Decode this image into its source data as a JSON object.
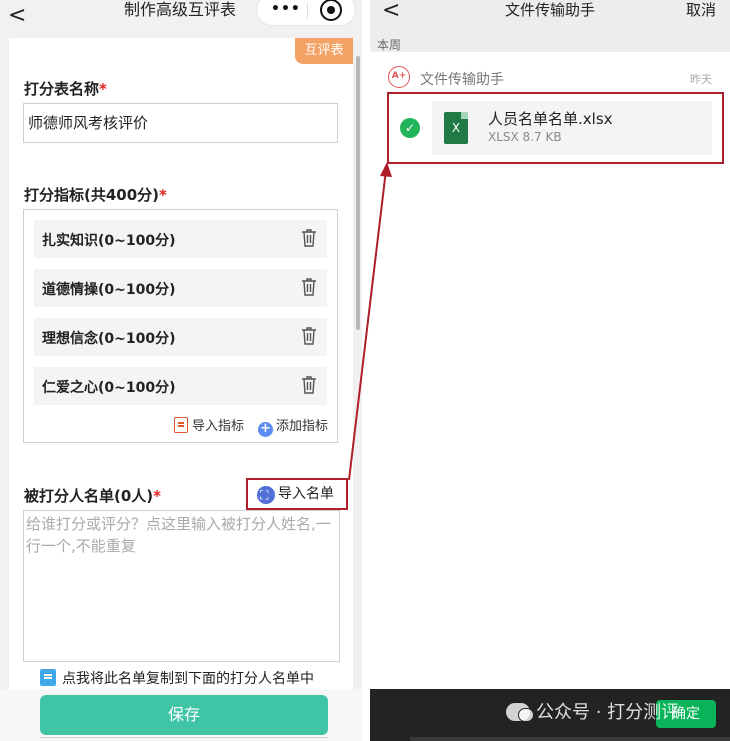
{
  "left": {
    "title": "制作高级互评表",
    "tag": "互评表",
    "form_name_label": "打分表名称",
    "form_name_value": "师德师风考核评价",
    "indicators_label": "打分指标(共400分)",
    "indicators": [
      "扎实知识(0~100分)",
      "道德情操(0~100分)",
      "理想信念(0~100分)",
      "仁爱之心(0~100分)"
    ],
    "import_indicators": "导入指标",
    "add_indicator": "添加指标",
    "targets_label": "被打分人名单(0人)",
    "import_list": "导入名单",
    "list_placeholder": "给谁打分或评分？点这里输入被打分人姓名,一行一个,不能重复",
    "copy_hint": "点我将此名单复制到下面的打分人名单中",
    "save": "保存",
    "required_mark": "*",
    "back_glyph": "<",
    "menu_glyph": "•••"
  },
  "right": {
    "title": "文件传输助手",
    "cancel": "取消",
    "section": "本周",
    "source_name": "文件传输助手",
    "source_time": "昨天",
    "file_name": "人员名单名单.xlsx",
    "file_meta": "XLSX 8.7 KB",
    "done": "确定",
    "back_glyph": "<",
    "source_icon_text": "A+",
    "file_icon_text": "X",
    "check_glyph": "✓"
  },
  "watermark": "公众号 · 打分测评",
  "colors": {
    "accent": "#40c4a6",
    "highlight": "#b01e2a",
    "tag": "#f5a267",
    "excel": "#1f7a44",
    "wechat_green": "#08b35a"
  }
}
